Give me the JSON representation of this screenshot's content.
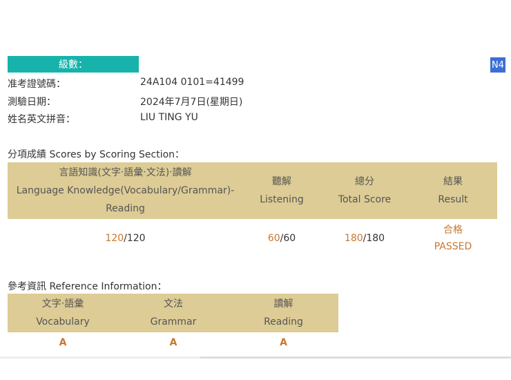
{
  "level": {
    "label": "級數：",
    "badge": "N4"
  },
  "info": [
    {
      "label": "准考證號碼：",
      "value": "24A104 0101=41499"
    },
    {
      "label": "測驗日期：",
      "value": "2024年7月7日(星期日)"
    },
    {
      "label": "姓名英文拼音：",
      "value": "LIU TING YU"
    }
  ],
  "scores": {
    "title": "分項成績 Scores by Scoring Section：",
    "headers": [
      {
        "zh": "言語知識(文字‧語彙‧文法)‧讀解",
        "en": "Language Knowledge(Vocabulary/Grammar)-Reading"
      },
      {
        "zh": "聽解",
        "en": "Listening"
      },
      {
        "zh": "總分",
        "en": "Total Score"
      },
      {
        "zh": "結果",
        "en": "Result"
      }
    ],
    "row": [
      {
        "score": "120",
        "max": "/120"
      },
      {
        "score": "60",
        "max": "/60"
      },
      {
        "score": "180",
        "max": "/180"
      }
    ],
    "result": {
      "zh": "合格",
      "en": "PASSED"
    }
  },
  "reference": {
    "title": "參考資訊 Reference Information：",
    "headers": [
      {
        "zh": "文字‧語彙",
        "en": "Vocabulary"
      },
      {
        "zh": "文法",
        "en": "Grammar"
      },
      {
        "zh": "讀解",
        "en": "Reading"
      }
    ],
    "grades": [
      "A",
      "A",
      "A"
    ]
  },
  "colors": {
    "level_bar": "#17b3ab",
    "badge": "#3c6fd6",
    "header_bg": "#ddcc95",
    "highlight": "#c8772e"
  }
}
